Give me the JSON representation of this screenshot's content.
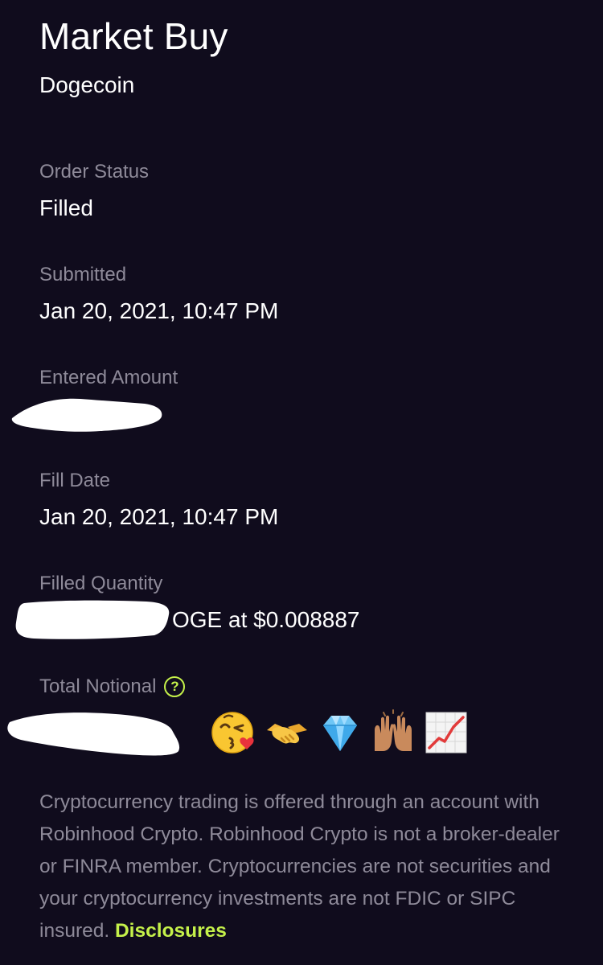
{
  "header": {
    "title": "Market Buy",
    "asset": "Dogecoin"
  },
  "details": {
    "order_status": {
      "label": "Order Status",
      "value": "Filled"
    },
    "submitted": {
      "label": "Submitted",
      "value": "Jan 20, 2021, 10:47 PM"
    },
    "entered_amount": {
      "label": "Entered Amount"
    },
    "fill_date": {
      "label": "Fill Date",
      "value": "Jan 20, 2021, 10:47 PM"
    },
    "filled_quantity": {
      "label": "Filled Quantity",
      "value_visible": "OGE at $0.008887"
    },
    "total_notional": {
      "label": "Total Notional",
      "help_icon": "question-circle-icon"
    }
  },
  "emojis": [
    "kissing-face-with-heart-icon",
    "handshake-icon",
    "gem-icon",
    "raising-hands-icon",
    "chart-increasing-icon"
  ],
  "disclaimer": {
    "text": "Cryptocurrency trading is offered through an account with Robinhood Crypto. Robinhood Crypto is not a broker-dealer or FINRA member. Cryptocurrencies are not securities and your cryptocurrency investments are not FDIC or SIPC insured.",
    "link_label": "Disclosures"
  },
  "colors": {
    "background": "#100c1d",
    "label": "#8e8a99",
    "accent": "#c5f14a"
  }
}
